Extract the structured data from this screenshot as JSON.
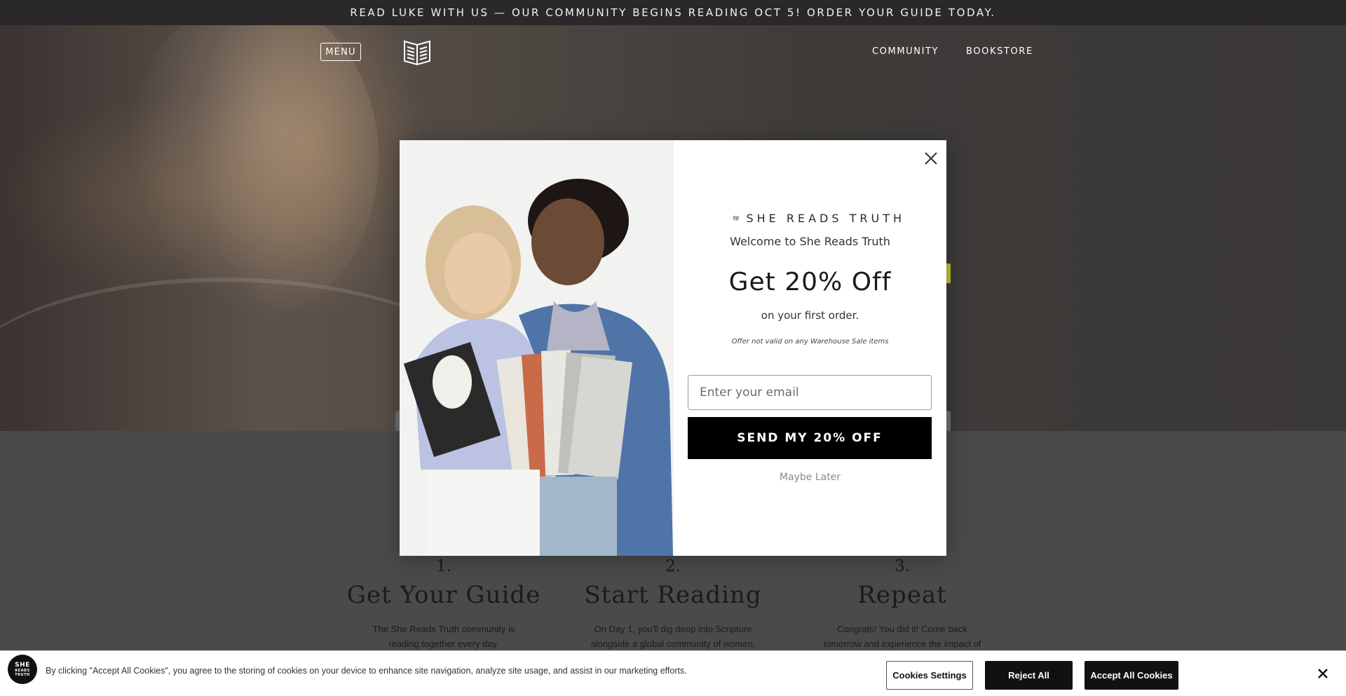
{
  "announcement": "READ LUKE WITH US — OUR COMMUNITY BEGINS READING OCT 5! ORDER YOUR GUIDE TODAY.",
  "nav": {
    "menu_label": "MENU",
    "logo_icon": "book-logo-icon",
    "links": [
      "COMMUNITY",
      "BOOKSTORE"
    ]
  },
  "steps": [
    {
      "number": "1.",
      "title": "Get Your Guide",
      "desc": "The She Reads Truth community is reading together every day."
    },
    {
      "number": "2.",
      "title": "Start Reading",
      "desc": "On Day 1, you'll dig deep into Scripture alongside a global community of women,"
    },
    {
      "number": "3.",
      "title": "Repeat",
      "desc": "Congrats! You did it! Come back tomorrow and experience the impact of"
    }
  ],
  "modal": {
    "brand": "SHE READS TRUTH",
    "welcome": "Welcome to She Reads Truth",
    "headline": "Get 20% Off",
    "subhead": "on your first order.",
    "fine_print": "Offer not valid on any Warehouse Sale items",
    "email_placeholder": "Enter your email",
    "submit_label": "SEND MY 20% OFF",
    "later_label": "Maybe Later",
    "close_icon": "close-icon"
  },
  "cookie": {
    "logo_lines": [
      "SHE",
      "READS",
      "TRUTH"
    ],
    "text": "By clicking \"Accept All Cookies\", you agree to the storing of cookies on your device to enhance site navigation, analyze site usage, and assist in our marketing efforts.",
    "settings_label": "Cookies Settings",
    "reject_label": "Reject All",
    "accept_label": "Accept All Cookies"
  },
  "colors": {
    "announcement_bg": "#2a2829",
    "accent": "#c4c036",
    "button_dark": "#111111"
  }
}
